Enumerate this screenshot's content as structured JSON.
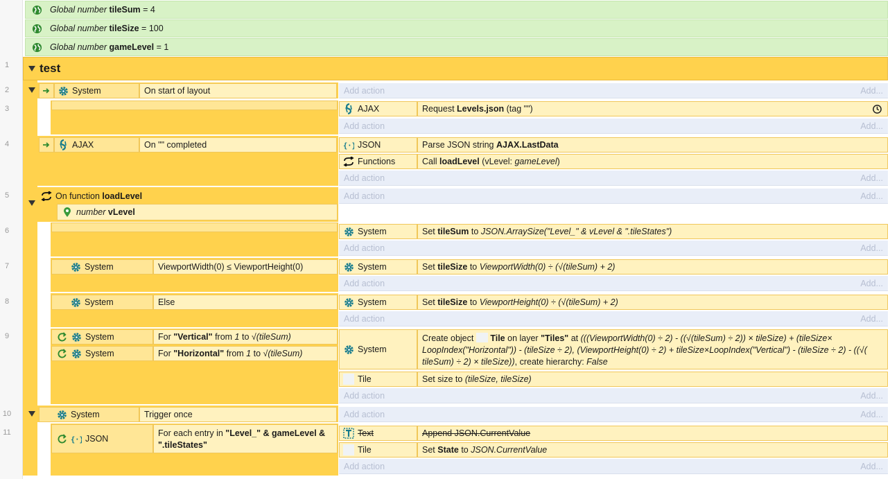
{
  "globals": [
    {
      "kw": "Global number",
      "name": "tileSum",
      "value": "= 4"
    },
    {
      "kw": "Global number",
      "name": "tileSize",
      "value": "= 100"
    },
    {
      "kw": "Global number",
      "name": "gameLevel",
      "value": "= 1"
    }
  ],
  "group": {
    "line": "1",
    "name": "test"
  },
  "lines": [
    "2",
    "3",
    "4",
    "5",
    "6",
    "7",
    "8",
    "9",
    "10",
    "11"
  ],
  "add_action": "Add action",
  "add_dots": "Add...",
  "ev2": {
    "obj": "System",
    "cond": "On start of layout"
  },
  "ev3": {
    "obj": "AJAX",
    "pre": "Request",
    "file": "Levels.json",
    "tag": "(tag \"\")"
  },
  "ev4": {
    "obj": "AJAX",
    "cond": "On \"\" completed",
    "a1": {
      "obj": "JSON",
      "pre": "Parse JSON string",
      "val": "AJAX.LastData"
    },
    "a2": {
      "obj": "Functions",
      "pre": "Call",
      "fn": "loadLevel",
      "args_open": "(vLevel:",
      "arg": "gameLevel",
      "args_close": ")"
    }
  },
  "ev5": {
    "pre": "On function",
    "fn": "loadLevel",
    "param_kw": "number",
    "param": "vLevel"
  },
  "ev6": {
    "obj": "System",
    "pre": "Set",
    "var": "tileSum",
    "to": "to",
    "expr": "JSON.ArraySize(\"Level_\" & vLevel & \".tileStates\")"
  },
  "ev7": {
    "obj": "System",
    "cond": "ViewportWidth(0) ≤ ViewportHeight(0)",
    "aobj": "System",
    "pre": "Set",
    "var": "tileSize",
    "to": "to",
    "expr": "ViewportWidth(0) ÷ (√(tileSum) + 2)"
  },
  "ev8": {
    "obj": "System",
    "cond": "Else",
    "aobj": "System",
    "pre": "Set",
    "var": "tileSize",
    "to": "to",
    "expr": "ViewportHeight(0) ÷ (√(tileSum) + 2)"
  },
  "ev9": {
    "c1": {
      "obj": "System",
      "pre": "For",
      "name": "\"Vertical\"",
      "from": "from",
      "n1": "1",
      "to": "to",
      "n2": "√(tileSum)"
    },
    "c2": {
      "obj": "System",
      "pre": "For",
      "name": "\"Horizontal\"",
      "from": "from",
      "n1": "1",
      "to": "to",
      "n2": "√(tileSum)"
    },
    "a1": {
      "obj": "System",
      "pre": "Create object",
      "objname": "Tile",
      "mid": "on layer",
      "layer": "\"Tiles\"",
      "at": "at",
      "expr": "(((ViewportWidth(0) ÷ 2) - ((√(tileSum) ÷ 2)) × tileSize) + (tileSize× LoopIndex(\"Horizontal\")) - (tileSize ÷ 2), (ViewportHeight(0) ÷ 2) + tileSize×LoopIndex(\"Vertical\") - (tileSize ÷ 2) - ((√( tileSum) ÷ 2) × tileSize))",
      "tail": ", create hierarchy:",
      "flag": "False"
    },
    "a2": {
      "obj": "Tile",
      "pre": "Set size to",
      "expr": "(tileSize, tileSize)"
    }
  },
  "ev10": {
    "obj": "System",
    "cond": "Trigger once"
  },
  "ev11": {
    "obj": "JSON",
    "pre": "For each entry in",
    "s1": "\"Level_\"",
    "amp1": "& gameLevel &",
    "s2": "\".tileStates\"",
    "a1": {
      "obj": "Text",
      "txt": "Append JSON.CurrentValue"
    },
    "a2": {
      "obj": "Tile",
      "pre": "Set",
      "var": "State",
      "to": "to",
      "expr": "JSON.CurrentValue"
    }
  },
  "colors": {
    "group": "#ffd24d",
    "block": "#fff2bf",
    "globals": "#d8f2c6",
    "add_row": "#e9eef8",
    "icon_teal": "#147a8c",
    "icon_green": "#2f8a2f"
  }
}
